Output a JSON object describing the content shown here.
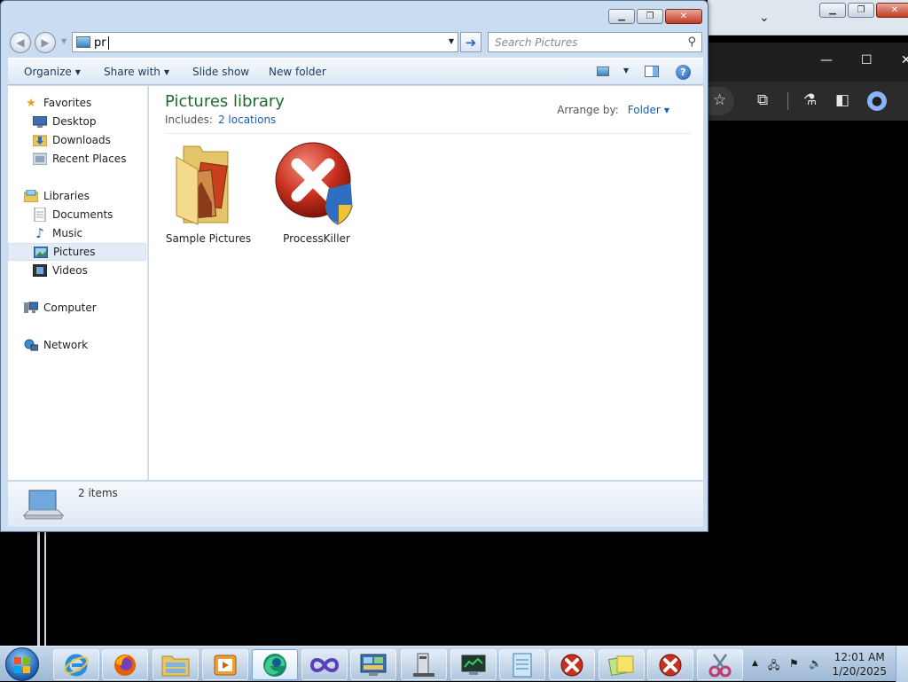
{
  "address_bar": {
    "value": "pr"
  },
  "search": {
    "placeholder": "Search Pictures"
  },
  "toolbar": {
    "organize": "Organize",
    "share_with": "Share with",
    "slide_show": "Slide show",
    "new_folder": "New folder"
  },
  "nav": {
    "favorites": "Favorites",
    "desktop": "Desktop",
    "downloads": "Downloads",
    "recent_places": "Recent Places",
    "libraries": "Libraries",
    "documents": "Documents",
    "music": "Music",
    "pictures": "Pictures",
    "videos": "Videos",
    "computer": "Computer",
    "network": "Network"
  },
  "library": {
    "title": "Pictures library",
    "includes_label": "Includes:",
    "includes_link": "2 locations",
    "arrange_label": "Arrange by:",
    "arrange_value": "Folder"
  },
  "files": [
    {
      "name": "Sample Pictures",
      "icon": "folder-pictures-icon"
    },
    {
      "name": "ProcessKiller",
      "icon": "process-killer-icon"
    }
  ],
  "status": {
    "count": "2 items"
  },
  "clock": {
    "time": "12:01 AM",
    "date": "1/20/2025"
  },
  "colors": {
    "library_title": "#1f6b2f",
    "link": "#1a5fb4",
    "close_button": "#c13a25"
  }
}
